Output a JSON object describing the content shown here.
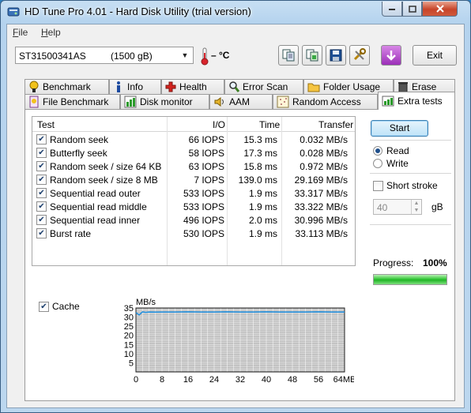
{
  "window": {
    "title": "HD Tune Pro 4.01 - Hard Disk Utility (trial version)"
  },
  "menu": [
    {
      "first": "F",
      "rest": "ile"
    },
    {
      "first": "H",
      "rest": "elp"
    }
  ],
  "toolbar": {
    "drive_name": "ST31500341AS",
    "drive_size": "(1500 gB)",
    "temperature": "– °C",
    "exit_label": "Exit"
  },
  "tabs_top": [
    "Benchmark",
    "Info",
    "Health",
    "Error Scan",
    "Folder Usage",
    "Erase"
  ],
  "tabs_bottom": [
    "File Benchmark",
    "Disk monitor",
    "AAM",
    "Random Access",
    "Extra tests"
  ],
  "table": {
    "headers": {
      "test": "Test",
      "io": "I/O",
      "time": "Time",
      "transfer": "Transfer"
    },
    "rows": [
      {
        "test": "Random seek",
        "io": "66 IOPS",
        "time": "15.3 ms",
        "transfer": "0.032 MB/s"
      },
      {
        "test": "Butterfly seek",
        "io": "58 IOPS",
        "time": "17.3 ms",
        "transfer": "0.028 MB/s"
      },
      {
        "test": "Random seek / size 64 KB",
        "io": "63 IOPS",
        "time": "15.8 ms",
        "transfer": "0.972 MB/s"
      },
      {
        "test": "Random seek / size 8 MB",
        "io": "7 IOPS",
        "time": "139.0 ms",
        "transfer": "29.169 MB/s"
      },
      {
        "test": "Sequential read outer",
        "io": "533 IOPS",
        "time": "1.9 ms",
        "transfer": "33.317 MB/s"
      },
      {
        "test": "Sequential read middle",
        "io": "533 IOPS",
        "time": "1.9 ms",
        "transfer": "33.322 MB/s"
      },
      {
        "test": "Sequential read inner",
        "io": "496 IOPS",
        "time": "2.0 ms",
        "transfer": "30.996 MB/s"
      },
      {
        "test": "Burst rate",
        "io": "530 IOPS",
        "time": "1.9 ms",
        "transfer": "33.113 MB/s"
      }
    ]
  },
  "controls": {
    "start_label": "Start",
    "read_label": "Read",
    "write_label": "Write",
    "short_stroke_label": "Short stroke",
    "stroke_value": "40",
    "stroke_unit": "gB",
    "progress_label": "Progress:",
    "progress_value": "100%",
    "progress_fraction": 1.0,
    "cache_label": "Cache"
  },
  "colors": {
    "grid": "#ffffff",
    "plot_bg": "#bcbcbc",
    "line": "#1d8fe0",
    "accent": "#3c7fb1"
  },
  "chart_data": {
    "type": "line",
    "ylabel": "MB/s",
    "xlabel": "",
    "x_unit": "MB",
    "ylim": [
      0,
      35
    ],
    "xlim": [
      0,
      64
    ],
    "yticks": [
      5,
      10,
      15,
      20,
      25,
      30,
      35
    ],
    "xticks": [
      "0",
      "8",
      "16",
      "24",
      "32",
      "40",
      "48",
      "56",
      "64MB"
    ],
    "grid": true,
    "series": [
      {
        "x": [
          0,
          1,
          2,
          3,
          4,
          6,
          8,
          12,
          16,
          20,
          24,
          28,
          32,
          36,
          40,
          44,
          48,
          52,
          56,
          60,
          64
        ],
        "values": [
          32.5,
          31.2,
          32.9,
          32.6,
          32.8,
          32.7,
          32.8,
          32.8,
          32.9,
          32.8,
          32.8,
          32.9,
          32.8,
          32.8,
          32.9,
          32.8,
          32.8,
          32.8,
          32.9,
          32.8,
          32.8
        ]
      }
    ]
  }
}
